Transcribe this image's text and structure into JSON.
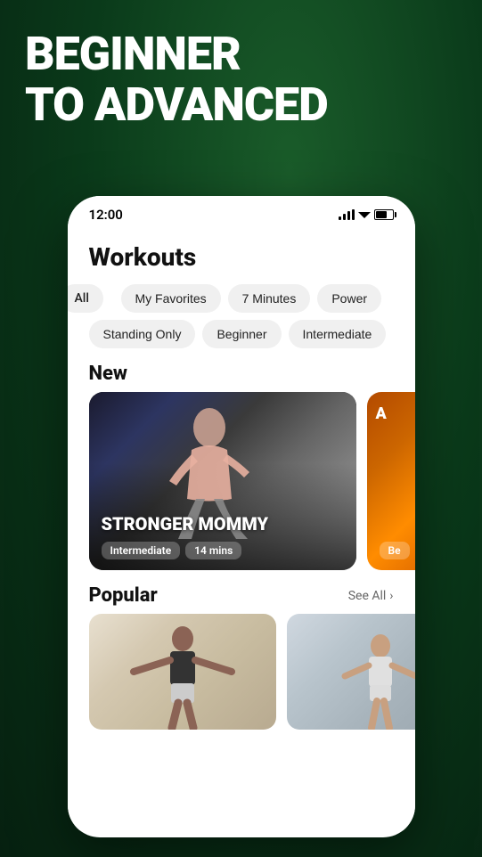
{
  "hero": {
    "line1": "BEGINNER",
    "line2": "TO ADVANCED"
  },
  "statusBar": {
    "time": "12:00"
  },
  "page": {
    "title": "Workouts"
  },
  "filterRow1": {
    "chips": [
      {
        "label": "All",
        "overflow": true
      },
      {
        "label": "My Favorites"
      },
      {
        "label": "7 Minutes"
      },
      {
        "label": "Power"
      }
    ]
  },
  "filterRow2": {
    "chips": [
      {
        "label": "Standing Only",
        "overflow": false
      },
      {
        "label": "Beginner"
      },
      {
        "label": "Intermediate"
      }
    ]
  },
  "newSection": {
    "label": "New",
    "cards": [
      {
        "title": "STRONGER MOMMY",
        "tags": [
          "Intermediate",
          "14 mins"
        ]
      },
      {
        "title": "A",
        "tags": [
          "Be"
        ]
      }
    ]
  },
  "popularSection": {
    "label": "Popular",
    "seeAll": "See All",
    "cards": [
      {
        "title": ""
      },
      {
        "title": ""
      }
    ]
  },
  "icons": {
    "chevronRight": "›"
  }
}
